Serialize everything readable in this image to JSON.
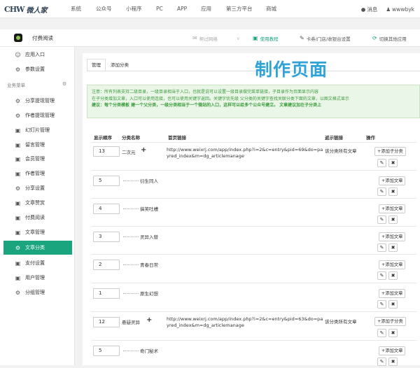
{
  "topbar": {
    "logo_mark": "CHW",
    "logo_text": "微人家",
    "nav": [
      "系统",
      "公众号",
      "小程序",
      "PC",
      "APP",
      "应用",
      "第三方平台",
      "商城"
    ],
    "messages_label": "消息",
    "username": "wwwbyk"
  },
  "subbar": {
    "app_title": "付费阅读",
    "help_label": "帮过网络",
    "tutorial_label": "使用教程",
    "cardstore_label": "卡券/门店/收银台设置",
    "switch_label": "切换其他应用"
  },
  "sidebar": {
    "top_items": [
      {
        "label": "应用入口",
        "icon": "smile-icon"
      },
      {
        "label": "参数设置",
        "icon": "gear-icon"
      }
    ],
    "group_label": "业务菜单",
    "items": [
      {
        "label": "分享提现管理",
        "icon": "gear-icon",
        "active": false
      },
      {
        "label": "作者提现管理",
        "icon": "gear-icon",
        "active": false
      },
      {
        "label": "幻灯片管理",
        "icon": "square-icon",
        "active": false
      },
      {
        "label": "留言管理",
        "icon": "square-icon",
        "active": false
      },
      {
        "label": "会员管理",
        "icon": "square-icon",
        "active": false
      },
      {
        "label": "作者管理",
        "icon": "square-icon",
        "active": false
      },
      {
        "label": "分享设置",
        "icon": "gear-icon",
        "active": false
      },
      {
        "label": "文章赞赏",
        "icon": "square-icon",
        "active": false
      },
      {
        "label": "付费阅读",
        "icon": "square-icon",
        "active": false
      },
      {
        "label": "文章管理",
        "icon": "square-icon",
        "active": false
      },
      {
        "label": "文章分类",
        "icon": "gear-icon",
        "active": true
      },
      {
        "label": "支付设置",
        "icon": "square-icon",
        "active": false
      },
      {
        "label": "用户管理",
        "icon": "square-icon",
        "active": false
      },
      {
        "label": "分组管理",
        "icon": "gear-icon",
        "active": false
      }
    ]
  },
  "main": {
    "tabs": [
      {
        "label": "管理",
        "active": true
      },
      {
        "label": "添加分类",
        "active": false
      }
    ],
    "overlay_title": "制作页面",
    "notice": {
      "line1": "注意：所有列表支持二级目录，一级目录相当于入口，也就是说可以设置一级目录做完菜单链接，子目录作为页面显示内容",
      "line2": "在子分类增加文章，入口可以使用连接，也可以使用关键字返回。关键字优先级 父分类的关键字查找关联分类下面的文章，以图文格式显示",
      "line3": "建议：每个分类模板 建一个父分类，一级分类相当于一个微站的入口，这样可以给多个公众号建立。 文章建议加在子分类上"
    },
    "table_headers": [
      "显示顺序",
      "分类名称",
      "首页链接",
      "返示链接",
      "操作"
    ],
    "rows": [
      {
        "order": "13",
        "name": "二次元",
        "parent": true,
        "url": "http://www.weixrj.com/app/index.php?i=2&c=entry&pid=69&do=payred_index&m=dg_articlemanage",
        "keyword": "该分类所有文章",
        "add_child": "添加子分类",
        "add_article": "添加文章"
      },
      {
        "order": "5",
        "name": "衍生同人",
        "parent": false,
        "add_article": "添加文章"
      },
      {
        "order": "4",
        "name": "搞笑吐槽",
        "parent": false,
        "add_article": "添加文章"
      },
      {
        "order": "3",
        "name": "灵异入替",
        "parent": false,
        "add_article": "添加文章"
      },
      {
        "order": "2",
        "name": "青春日常",
        "parent": false,
        "add_article": "添加文章"
      },
      {
        "order": "1",
        "name": "原生幻想",
        "parent": false,
        "add_article": "添加文章"
      },
      {
        "order": "12",
        "name": "悬疑灵异",
        "parent": true,
        "url": "http://www.weixrj.com/app/index.php?i=2&c=entry&pid=63&do=payred_index&m=dg_articlemanage",
        "keyword": "该分类所有文章",
        "add_child": "添加子分类",
        "add_article": "添加文章"
      },
      {
        "order": "5",
        "name": "奇门秘术",
        "parent": false,
        "add_article": "添加文章"
      }
    ]
  },
  "colors": {
    "accent": "#1aa57f",
    "overlay": "#2fa3d6",
    "notice_text": "#3c9c3c",
    "notice_bg": "#eaf6e7"
  }
}
